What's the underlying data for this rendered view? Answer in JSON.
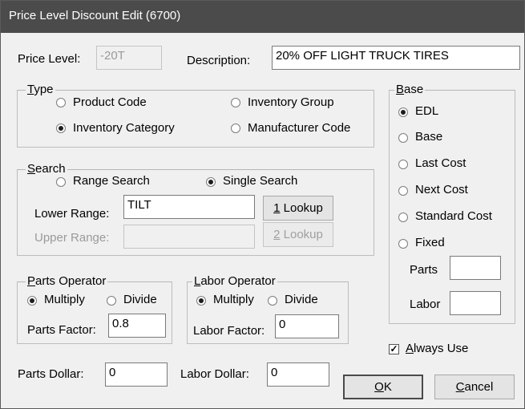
{
  "window": {
    "title": "Price Level Discount Edit (6700)"
  },
  "price_level": {
    "label": "Price Level:",
    "value": "-20T"
  },
  "description": {
    "label": "Description:",
    "value": "20% OFF LIGHT TRUCK TIRES"
  },
  "type": {
    "legend_mnemonic": "T",
    "legend_rest": "ype",
    "options": [
      "Product Code",
      "Inventory Group",
      "Inventory Category",
      "Manufacturer Code"
    ],
    "selected": "Inventory Category"
  },
  "base": {
    "legend_mnemonic": "B",
    "legend_rest": "ase",
    "options": [
      "EDL",
      "Base",
      "Last Cost",
      "Next Cost",
      "Standard Cost",
      "Fixed"
    ],
    "selected": "EDL",
    "parts_label": "Parts",
    "parts_value": "",
    "labor_label": "Labor",
    "labor_value": ""
  },
  "search": {
    "legend_mnemonic": "S",
    "legend_rest": "earch",
    "range_label": "Range Search",
    "single_label": "Single Search",
    "selected": "Single Search",
    "lower_label": "Lower Range:",
    "lower_value": "TILT",
    "upper_label": "Upper Range:",
    "upper_value": "",
    "lookup1_mnemonic": "1",
    "lookup1_rest": " Lookup",
    "lookup2_mnemonic": "2",
    "lookup2_rest": " Lookup"
  },
  "parts_operator": {
    "legend_mnemonic": "P",
    "legend_rest": "arts Operator",
    "multiply": "Multiply",
    "divide": "Divide",
    "selected": "Multiply",
    "factor_label": "Parts Factor:",
    "factor_value": "0.8"
  },
  "labor_operator": {
    "legend_mnemonic": "L",
    "legend_rest": "abor Operator",
    "multiply": "Multiply",
    "divide": "Divide",
    "selected": "Multiply",
    "factor_label": "Labor Factor:",
    "factor_value": "0"
  },
  "always_use": {
    "mnemonic": "A",
    "rest": "lways Use",
    "checked": true
  },
  "parts_dollar": {
    "label": "Parts Dollar:",
    "value": "0"
  },
  "labor_dollar": {
    "label": "Labor Dollar:",
    "value": "0"
  },
  "ok_button": {
    "mnemonic": "O",
    "rest": "K"
  },
  "cancel_button": {
    "mnemonic": "C",
    "rest": "ancel"
  }
}
